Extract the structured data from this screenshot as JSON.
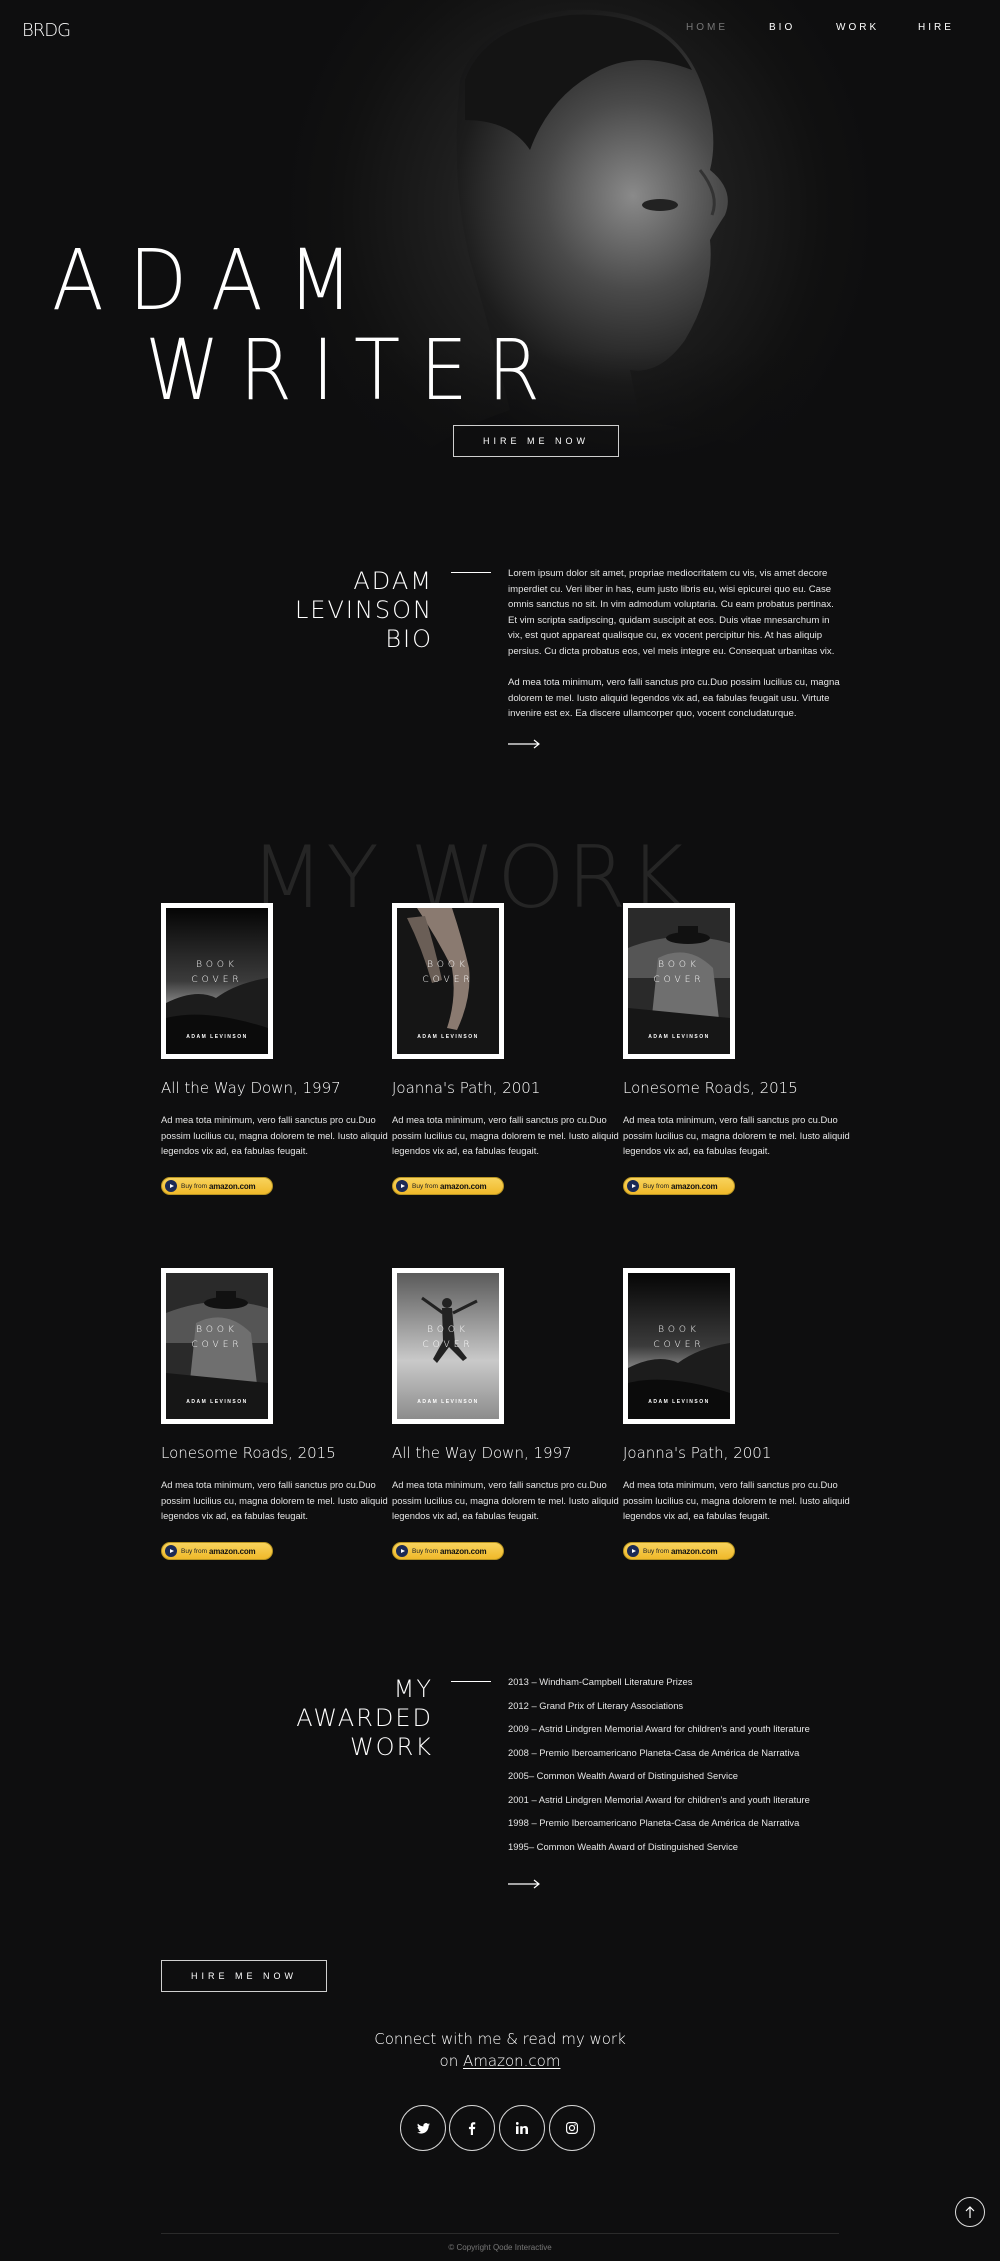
{
  "header": {
    "logo": "BRDG",
    "nav": [
      {
        "label": "HOME",
        "active": true
      },
      {
        "label": "BIO"
      },
      {
        "label": "WORK"
      },
      {
        "label": "HIRE"
      }
    ]
  },
  "hero": {
    "title_line1": "ADAM",
    "title_line2": "WRITER",
    "cta": "HIRE ME NOW"
  },
  "bio": {
    "title_lines": [
      "ADAM",
      "LEVINSON",
      "BIO"
    ],
    "paragraph1": "Lorem ipsum dolor sit amet, propriae mediocritatem cu vis, vis amet decore imperdiet cu. Veri liber in has, eum justo libris eu, wisi epicurei quo eu. Case omnis sanctus no sit. In vim admodum voluptaria. Cu eam probatus pertinax. Et vim scripta sadipscing, quidam suscipit at eos. Duis vitae mnesarchum in vix, est quot appareat qualisque cu, ex vocent percipitur his. At has aliquip persius. Cu dicta probatus eos, vel meis integre eu. Consequat urbanitas vix.",
    "paragraph2": "Ad mea tota minimum, vero falli sanctus pro cu.Duo possim lucilius cu, magna dolorem te mel. Iusto aliquid legendos vix ad, ea fabulas feugait usu. Virtute invenire est ex. Ea discere ullamcorper quo, vocent concludaturque."
  },
  "work": {
    "watermark": "MY WORK",
    "cover_label_lines": [
      "BOOK",
      "COVER"
    ],
    "cover_author": "ADAM LEVINSON",
    "amazon_buy": "Buy from",
    "amazon_brand": "amazon.com",
    "items": [
      {
        "title": "All the Way Down, 1997",
        "desc": "Ad mea tota minimum, vero falli sanctus pro cu.Duo possim lucilius cu, magna dolorem te mel. Iusto aliquid legendos vix ad, ea fabulas feugait.",
        "cover": "coast"
      },
      {
        "title": "Joanna's Path, 2001",
        "desc": "Ad mea tota minimum, vero falli sanctus pro cu.Duo possim lucilius cu, magna dolorem te mel. Iusto aliquid legendos vix ad, ea fabulas feugait.",
        "cover": "dancer"
      },
      {
        "title": "Lonesome Roads, 2015",
        "desc": "Ad mea tota minimum, vero falli sanctus pro cu.Duo possim lucilius cu, magna dolorem te mel. Iusto aliquid legendos vix ad, ea fabulas feugait.",
        "cover": "hat"
      },
      {
        "title": "Lonesome Roads, 2015",
        "desc": "Ad mea tota minimum, vero falli sanctus pro cu.Duo possim lucilius cu, magna dolorem te mel. Iusto aliquid legendos vix ad, ea fabulas feugait.",
        "cover": "hat"
      },
      {
        "title": "All the Way Down, 1997",
        "desc": "Ad mea tota minimum, vero falli sanctus pro cu.Duo possim lucilius cu, magna dolorem te mel. Iusto aliquid legendos vix ad, ea fabulas feugait.",
        "cover": "jump"
      },
      {
        "title": "Joanna's Path, 2001",
        "desc": "Ad mea tota minimum, vero falli sanctus pro cu.Duo possim lucilius cu, magna dolorem te mel. Iusto aliquid legendos vix ad, ea fabulas feugait.",
        "cover": "coast"
      }
    ]
  },
  "awards": {
    "title_lines": [
      "MY",
      "AWARDED",
      "WORK"
    ],
    "items": [
      "2013 – Windham-Campbell Literature Prizes",
      "2012 – Grand Prix of Literary Associations",
      "2009 – Astrid Lindgren Memorial Award for children's and youth literature",
      "2008 – Premio Iberoamericano Planeta-Casa de América de Narrativa",
      "2005– Common Wealth Award of Distinguished Service",
      "2001 – Astrid Lindgren Memorial Award for children's and youth literature",
      "1998 – Premio Iberoamericano Planeta-Casa de América de Narrativa",
      "1995– Common Wealth Award of Distinguished Service"
    ]
  },
  "footer": {
    "cta": "HIRE ME NOW",
    "connect_line1": "Connect with me & read my work",
    "connect_on": "on",
    "connect_link": "Amazon.com",
    "social": [
      "twitter-icon",
      "facebook-icon",
      "linkedin-icon",
      "instagram-icon"
    ],
    "copyright": "© Copyright Qode Interactive"
  },
  "colors": {
    "background": "#0e0e0f",
    "amazon_button": "#f3c33b",
    "watermark": "#252525"
  }
}
